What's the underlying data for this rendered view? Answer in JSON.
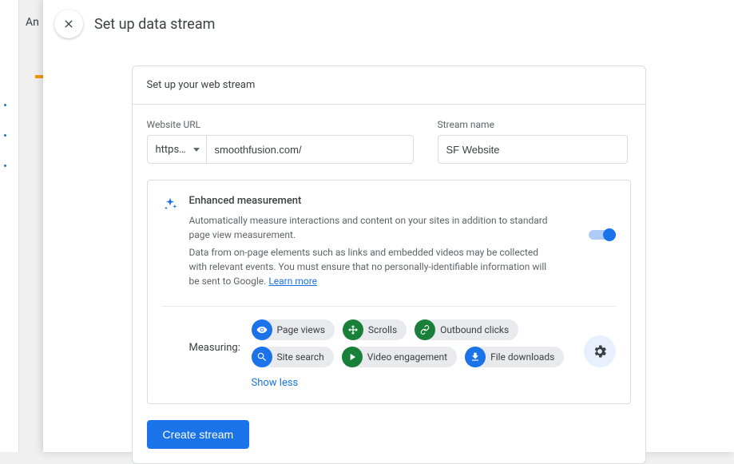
{
  "background": {
    "label": "An"
  },
  "header": {
    "title": "Set up data stream"
  },
  "card": {
    "header": "Set up your web stream",
    "url_label": "Website URL",
    "protocol": "https…",
    "url_value": "smoothfusion.com/",
    "name_label": "Stream name",
    "name_value": "SF Website"
  },
  "enhanced": {
    "title": "Enhanced measurement",
    "paragraph1": "Automatically measure interactions and content on your sites in addition to standard page\nview measurement.",
    "paragraph2": "Data from on-page elements such as links and embedded videos may be collected with relevant events. You must ensure that no personally-identifiable information will be sent to Google. ",
    "learn_more": "Learn more",
    "toggle_on": true
  },
  "measuring": {
    "label": "Measuring:",
    "chips": [
      {
        "label": "Page views",
        "color": "blue",
        "icon": "eye"
      },
      {
        "label": "Scrolls",
        "color": "green",
        "icon": "scroll"
      },
      {
        "label": "Outbound clicks",
        "color": "green",
        "icon": "link"
      },
      {
        "label": "Site search",
        "color": "blue",
        "icon": "search"
      },
      {
        "label": "Video engagement",
        "color": "green",
        "icon": "play"
      },
      {
        "label": "File downloads",
        "color": "blue",
        "icon": "download"
      }
    ],
    "show_less": "Show less"
  },
  "actions": {
    "create": "Create stream"
  }
}
